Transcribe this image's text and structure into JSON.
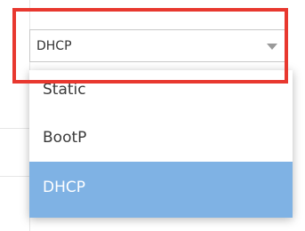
{
  "select": {
    "value": "DHCP"
  },
  "dropdown": {
    "options": [
      {
        "label": "Static",
        "selected": false
      },
      {
        "label": "BootP",
        "selected": false
      },
      {
        "label": "DHCP",
        "selected": true
      }
    ]
  },
  "colors": {
    "highlight_border": "#e8382f",
    "selected_option_bg": "#7fb2e4"
  }
}
